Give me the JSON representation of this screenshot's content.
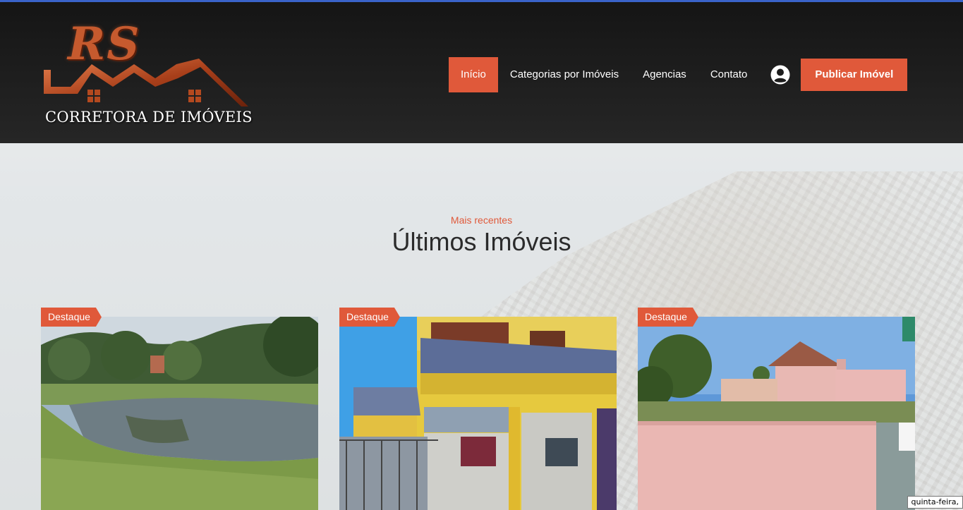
{
  "header": {
    "logo": {
      "monogram": "RS",
      "tagline": "CORRETORA DE IMÓVEIS"
    },
    "nav": [
      {
        "label": "Início",
        "active": true
      },
      {
        "label": "Categorias por Imóveis",
        "active": false
      },
      {
        "label": "Agencias",
        "active": false
      },
      {
        "label": "Contato",
        "active": false
      }
    ],
    "user_icon": "user-circle-icon",
    "publish_label": "Publicar Imóvel"
  },
  "section": {
    "subtitle": "Mais recentes",
    "title": "Últimos Imóveis"
  },
  "listings": [
    {
      "badge": "Destaque",
      "photo": "pond-landscape",
      "favorite_icon": "heart-icon"
    },
    {
      "badge": "Destaque",
      "photo": "yellow-two-story-building",
      "favorite_icon": "heart-icon"
    },
    {
      "badge": "Destaque",
      "photo": "pink-house-with-wall",
      "favorite_icon": "heart-icon"
    }
  ],
  "taskbar": {
    "clock_text": "quinta-feira,"
  },
  "colors": {
    "accent": "#e0593a",
    "header_bg": "#1d1d1d",
    "top_line": "#3a63c9"
  }
}
